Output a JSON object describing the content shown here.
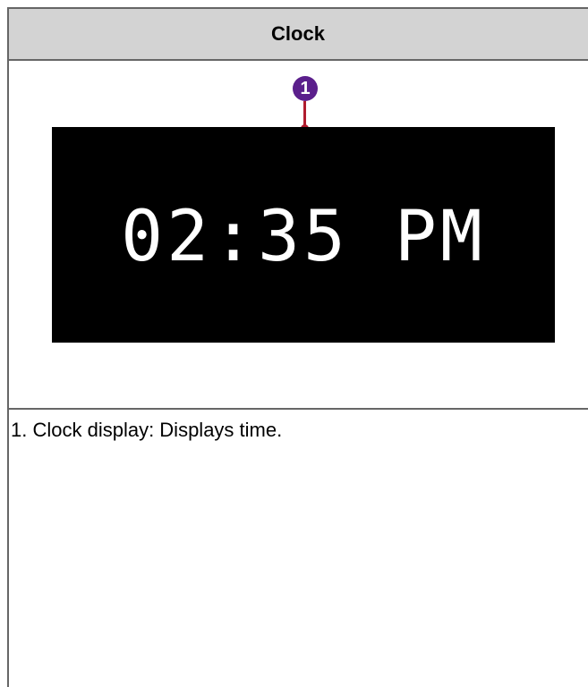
{
  "header": {
    "title": "Clock"
  },
  "figure": {
    "clock_display": "02:35 PM",
    "callout_number": "1"
  },
  "description": {
    "items": [
      "1. Clock display: Displays time."
    ]
  },
  "colors": {
    "header_background": "#d3d3d3",
    "border": "#666666",
    "screen_background": "#000000",
    "clock_text": "#ffffff",
    "callout_badge": "#5b1f8c",
    "callout_line": "#b01c2e"
  }
}
